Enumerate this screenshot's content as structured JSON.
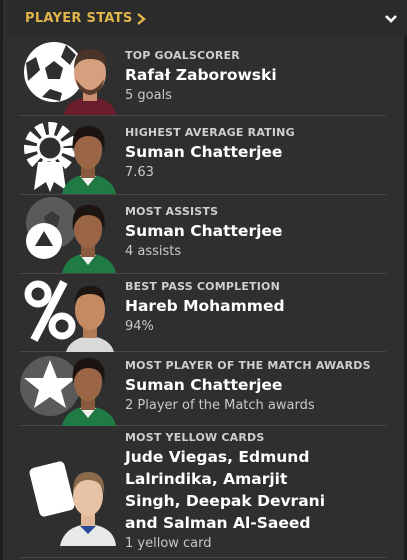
{
  "header": {
    "title": "PLAYER STATS"
  },
  "stats": [
    {
      "label": "TOP GOALSCORER",
      "player": "Rafał Zaborowski",
      "value": "5 goals"
    },
    {
      "label": "HIGHEST AVERAGE RATING",
      "player": "Suman Chatterjee",
      "value": "7.63"
    },
    {
      "label": "MOST ASSISTS",
      "player": "Suman Chatterjee",
      "value": "4 assists"
    },
    {
      "label": "BEST PASS COMPLETION",
      "player": "Hareb Mohammed",
      "value": "94%"
    },
    {
      "label": "MOST PLAYER OF THE MATCH AWARDS",
      "player": "Suman Chatterjee",
      "value": "2 Player of the Match awards"
    },
    {
      "label": "MOST YELLOW CARDS",
      "player": "Jude Viegas, Edmund Lalrindika, Amarjit Singh, Deepak Devrani and Salman Al-Saeed",
      "value": "1 yellow card"
    }
  ],
  "icons": {
    "row0": "football-icon",
    "row1": "rating-badge-icon",
    "row2": "assist-icon",
    "row3": "percent-icon",
    "row4": "star-icon",
    "row5": "yellow-card-icon"
  },
  "colors": {
    "accent": "#e0b54a",
    "background": "#2f2f2f",
    "text_muted": "#c8c8c8"
  }
}
